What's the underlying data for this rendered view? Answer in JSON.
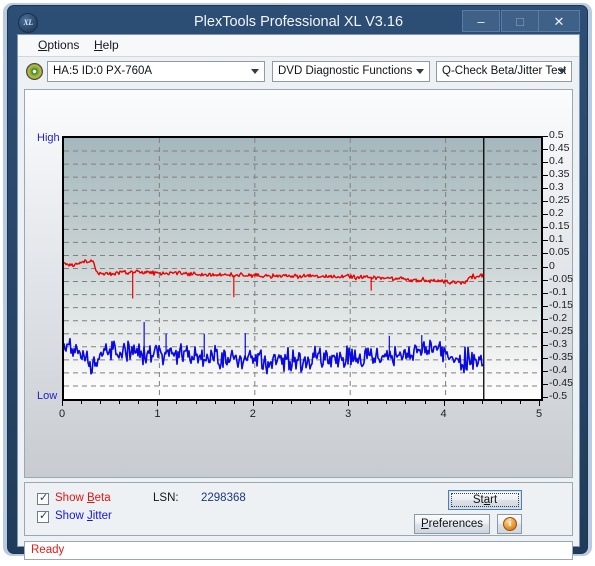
{
  "window": {
    "title": "PlexTools Professional XL V3.16",
    "logo_text": "XL",
    "minimize": "–",
    "maximize": "□",
    "close": "✕"
  },
  "menu": {
    "options": "Options",
    "options_accel": "O",
    "options_rest": "ptions",
    "help": "Help",
    "help_accel": "H",
    "help_rest": "elp"
  },
  "toolbar": {
    "drive": "HA:5 ID:0  PX-760A",
    "function": "DVD Diagnostic Functions",
    "test": "Q-Check Beta/Jitter Test",
    "disc_icon": "disc-icon"
  },
  "controls": {
    "show_beta_label_pre": "Show ",
    "show_beta_accel": "B",
    "show_beta_rest": "eta",
    "show_jitter_label_pre": "Show ",
    "show_jitter_accel": "J",
    "show_jitter_rest": "itter",
    "show_beta_checked": "true",
    "show_jitter_checked": "true",
    "lsn_label": "LSN:",
    "lsn_value": "2298368",
    "start_accel": "St",
    "start_accel_letter": "a",
    "start_rest": "rt",
    "start_label": "Start",
    "preferences_accel": "P",
    "preferences_rest": "references",
    "preferences_label": "Preferences",
    "info_glyph": "i"
  },
  "status": {
    "text": "Ready"
  },
  "chart_data": {
    "type": "line",
    "title": "",
    "xlabel": "",
    "ylabel": "",
    "xlim": [
      0,
      5
    ],
    "ylim": [
      -0.5,
      0.5
    ],
    "grid": true,
    "y_axis_left_labels": [
      "High",
      "Low"
    ],
    "yticks": [
      0.5,
      0.45,
      0.4,
      0.35,
      0.3,
      0.25,
      0.2,
      0.15,
      0.1,
      0.05,
      0,
      -0.05,
      -0.1,
      -0.15,
      -0.2,
      -0.25,
      -0.3,
      -0.35,
      -0.4,
      -0.45,
      -0.5
    ],
    "ytick_labels": [
      "0.5",
      "0.45",
      "0.4",
      "0.35",
      "0.3",
      "0.25",
      "0.2",
      "0.15",
      "0.1",
      "0.05",
      "0",
      "-0.05",
      "-0.1",
      "-0.15",
      "-0.2",
      "-0.25",
      "-0.3",
      "-0.35",
      "-0.4",
      "-0.45",
      "-0.5"
    ],
    "xticks": [
      0,
      1,
      2,
      3,
      4,
      5
    ],
    "xtick_labels": [
      "0",
      "1",
      "2",
      "3",
      "4",
      "5"
    ],
    "data_end_x": 4.4,
    "colors": {
      "beta": "#ee0000",
      "jitter": "#0a0ae0",
      "grid": "#808080",
      "axis": "#000000"
    },
    "series": [
      {
        "name": "Beta",
        "color": "#ee0000",
        "x": [
          0.0,
          0.05,
          0.1,
          0.15,
          0.2,
          0.25,
          0.3,
          0.35,
          0.4,
          0.5,
          0.6,
          0.7,
          0.8,
          0.9,
          1.0,
          1.1,
          1.2,
          1.3,
          1.4,
          1.5,
          1.6,
          1.7,
          1.8,
          1.9,
          2.0,
          2.1,
          2.2,
          2.3,
          2.4,
          2.5,
          2.6,
          2.7,
          2.8,
          2.9,
          3.0,
          3.1,
          3.2,
          3.3,
          3.4,
          3.5,
          3.6,
          3.7,
          3.8,
          3.9,
          4.0,
          4.1,
          4.2,
          4.25,
          4.3,
          4.4
        ],
        "y": [
          0.022,
          0.012,
          0.01,
          0.02,
          0.028,
          0.03,
          0.028,
          -0.018,
          -0.02,
          -0.018,
          -0.016,
          -0.014,
          -0.012,
          -0.016,
          -0.018,
          -0.016,
          -0.018,
          -0.02,
          -0.022,
          -0.022,
          -0.024,
          -0.024,
          -0.026,
          -0.026,
          -0.026,
          -0.028,
          -0.028,
          -0.028,
          -0.028,
          -0.03,
          -0.03,
          -0.03,
          -0.03,
          -0.032,
          -0.032,
          -0.034,
          -0.034,
          -0.036,
          -0.038,
          -0.04,
          -0.042,
          -0.044,
          -0.046,
          -0.048,
          -0.05,
          -0.052,
          -0.054,
          -0.03,
          -0.028,
          -0.028
        ],
        "noise": 0.006
      },
      {
        "name": "Jitter",
        "color": "#0a0ae0",
        "x": [
          0.0,
          0.05,
          0.1,
          0.15,
          0.2,
          0.25,
          0.3,
          0.35,
          0.4,
          0.5,
          0.6,
          0.7,
          0.8,
          0.9,
          1.0,
          1.1,
          1.2,
          1.3,
          1.4,
          1.5,
          1.6,
          1.7,
          1.8,
          1.9,
          2.0,
          2.1,
          2.2,
          2.3,
          2.4,
          2.5,
          2.6,
          2.7,
          2.8,
          2.9,
          3.0,
          3.1,
          3.2,
          3.3,
          3.4,
          3.5,
          3.6,
          3.7,
          3.8,
          3.9,
          4.0,
          4.05,
          4.1,
          4.2,
          4.3,
          4.4
        ],
        "y": [
          -0.3,
          -0.295,
          -0.3,
          -0.315,
          -0.34,
          -0.36,
          -0.37,
          -0.355,
          -0.32,
          -0.315,
          -0.318,
          -0.32,
          -0.322,
          -0.325,
          -0.328,
          -0.33,
          -0.332,
          -0.335,
          -0.338,
          -0.34,
          -0.342,
          -0.344,
          -0.346,
          -0.348,
          -0.345,
          -0.348,
          -0.35,
          -0.352,
          -0.35,
          -0.348,
          -0.344,
          -0.34,
          -0.338,
          -0.34,
          -0.342,
          -0.344,
          -0.34,
          -0.336,
          -0.332,
          -0.328,
          -0.324,
          -0.32,
          -0.316,
          -0.312,
          -0.31,
          -0.345,
          -0.35,
          -0.352,
          -0.35,
          -0.348
        ],
        "noise": 0.03
      }
    ],
    "spikes": [
      {
        "series": "Jitter",
        "x": 0.84,
        "y": -0.205
      },
      {
        "series": "Jitter",
        "x": 1.07,
        "y": -0.25
      },
      {
        "series": "Jitter",
        "x": 1.47,
        "y": -0.25
      },
      {
        "series": "Jitter",
        "x": 1.9,
        "y": -0.248
      },
      {
        "series": "Jitter",
        "x": 3.41,
        "y": -0.258
      },
      {
        "series": "Jitter",
        "x": 3.75,
        "y": -0.255
      },
      {
        "series": "Beta",
        "x": 0.72,
        "y": -0.115
      },
      {
        "series": "Beta",
        "x": 1.78,
        "y": -0.11
      },
      {
        "series": "Beta",
        "x": 3.22,
        "y": -0.085
      }
    ]
  }
}
